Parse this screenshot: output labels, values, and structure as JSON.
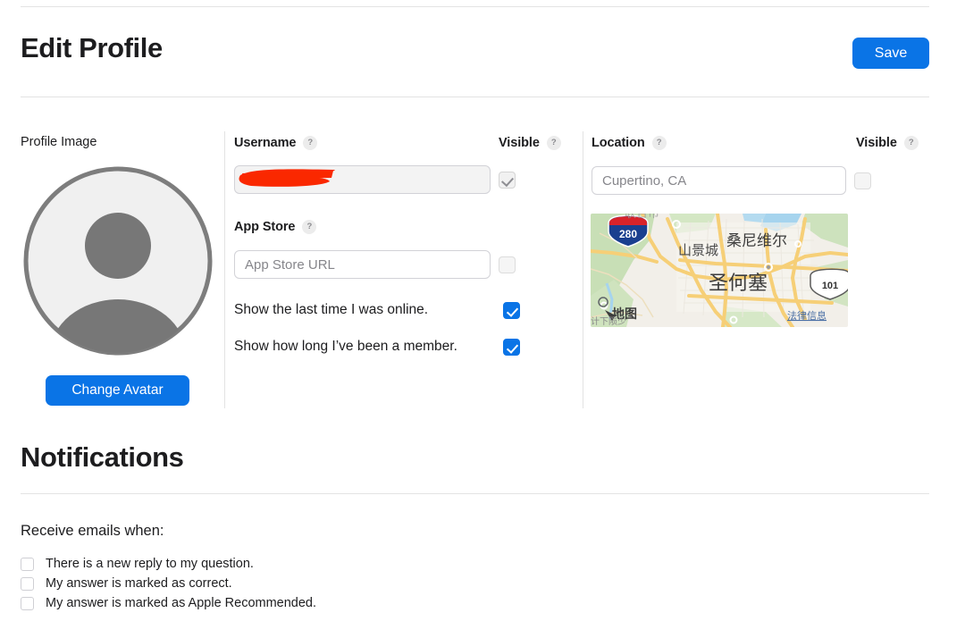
{
  "header": {
    "title": "Edit Profile",
    "save_label": "Save",
    "accent_color": "#0a74e6"
  },
  "profile": {
    "image_label": "Profile Image",
    "change_avatar_label": "Change Avatar",
    "avatar_icon": "person-avatar-placeholder-icon"
  },
  "fields": {
    "username": {
      "label": "Username",
      "help_icon": "?",
      "value": "",
      "placeholder": "",
      "redacted": true,
      "redaction_color": "#fa2800",
      "visible_label": "Visible",
      "visible_help_icon": "?",
      "visible_checked": true,
      "disabled": true
    },
    "app_store": {
      "label": "App Store",
      "help_icon": "?",
      "value": "",
      "placeholder": "App Store URL",
      "visible_checked": false
    },
    "location": {
      "label": "Location",
      "help_icon": "?",
      "value": "",
      "placeholder": "Cupertino, CA",
      "visible_label": "Visible",
      "visible_help_icon": "?",
      "visible_checked": false
    }
  },
  "toggles": [
    {
      "label": "Show the last time I was online.",
      "checked": true
    },
    {
      "label": "Show how long I’ve been a member.",
      "checked": true
    }
  ],
  "map": {
    "name": "location-map-thumbnail",
    "labels": {
      "sunnyvale": "桑尼维尔",
      "mountain_view": "山景城",
      "san_jose": "圣何塞",
      "attribution": "地图",
      "legal": "法律信息",
      "partial_top": "联合市"
    },
    "shields": [
      "280",
      "101"
    ]
  },
  "notifications": {
    "title": "Notifications",
    "intro": "Receive emails when:",
    "items": [
      {
        "label": "There is a new reply to my question.",
        "checked": false
      },
      {
        "label": "My answer is marked as correct.",
        "checked": false
      },
      {
        "label": "My answer is marked as Apple Recommended.",
        "checked": false
      }
    ]
  }
}
